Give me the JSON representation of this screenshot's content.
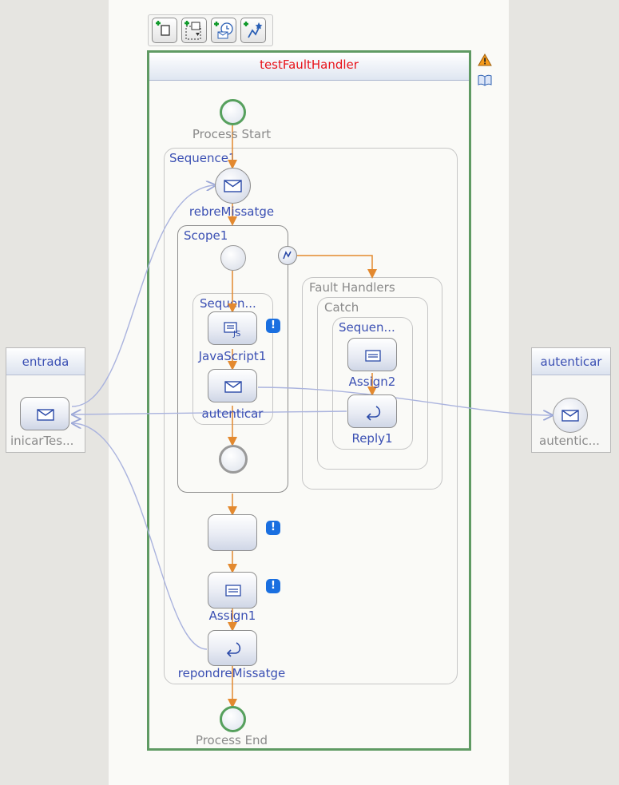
{
  "process": {
    "title": "testFaultHandler",
    "start_label": "Process Start",
    "end_label": "Process End"
  },
  "toolbar": {
    "buttons": [
      "add-activity-icon",
      "add-sequence-icon",
      "add-event-icon",
      "add-link-icon"
    ]
  },
  "side_icons": [
    "warning-icon",
    "book-icon"
  ],
  "partners": {
    "left": {
      "title": "entrada",
      "operation_label": "inicarTes..."
    },
    "right": {
      "title": "autenticar",
      "operation_label": "autentic..."
    }
  },
  "sequence1": {
    "label": "Sequence1",
    "receive_label": "rebreMissatge"
  },
  "scope1": {
    "label": "Scope1",
    "inner_sequence_label": "Sequen...",
    "javascript_label": "JavaScript1",
    "invoke_label": "autenticar"
  },
  "fault_handlers": {
    "label": "Fault Handlers",
    "catch_label": "Catch",
    "sequence_label": "Sequen...",
    "assign_label": "Assign2",
    "reply_label": "Reply1"
  },
  "after_scope": {
    "assign_label": "Assign1",
    "reply_label": "repondreMissatge"
  },
  "badges": {
    "warning_mark": "!"
  },
  "colors": {
    "process_border": "#5f9a63",
    "title": "#e8131a",
    "flow": "#e3892f",
    "partner_link": "#a9b5dd",
    "label": "#3a4fb3"
  }
}
